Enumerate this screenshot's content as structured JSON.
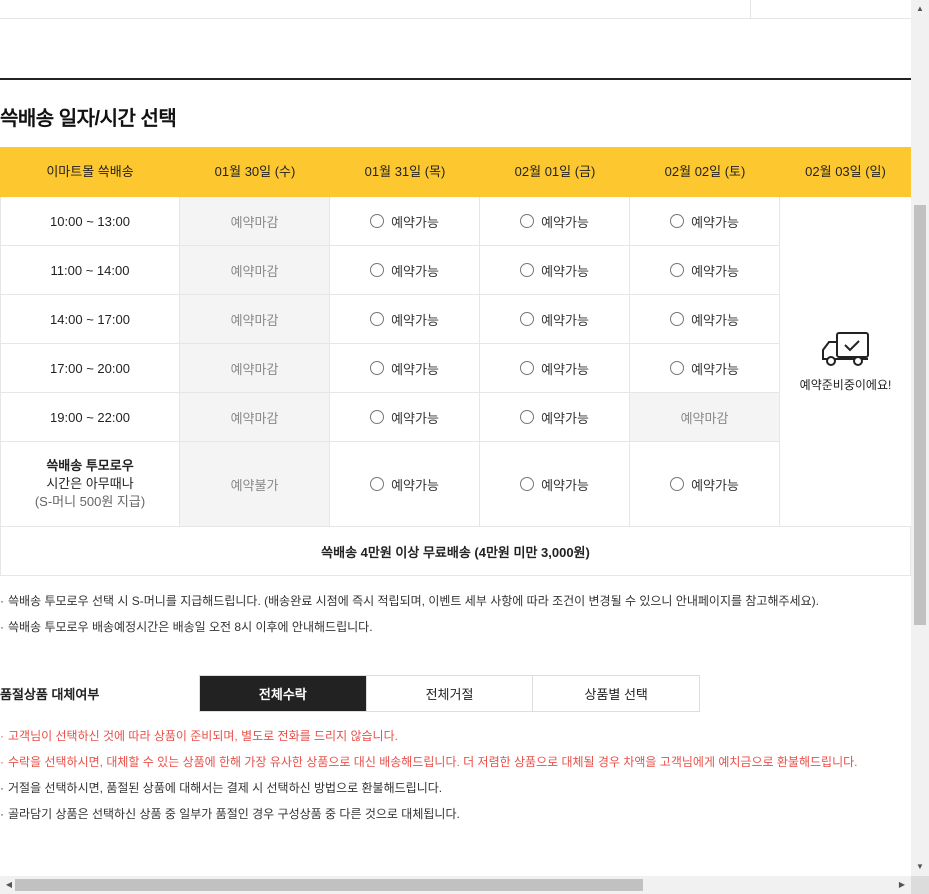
{
  "page": {
    "section_title": "쓱배송 일자/시간 선택"
  },
  "schedule": {
    "header": {
      "label": "이마트몰 쓱배송",
      "dates": [
        "01월 30일 (수)",
        "01월 31일 (목)",
        "02월 01일 (금)",
        "02월 02일 (토)",
        "02월 03일 (일)"
      ]
    },
    "rows": [
      {
        "time": "10:00 ~ 13:00",
        "slots": [
          "예약마감",
          "예약가능",
          "예약가능",
          "예약가능"
        ]
      },
      {
        "time": "11:00 ~ 14:00",
        "slots": [
          "예약마감",
          "예약가능",
          "예약가능",
          "예약가능"
        ]
      },
      {
        "time": "14:00 ~ 17:00",
        "slots": [
          "예약마감",
          "예약가능",
          "예약가능",
          "예약가능"
        ]
      },
      {
        "time": "17:00 ~ 20:00",
        "slots": [
          "예약마감",
          "예약가능",
          "예약가능",
          "예약가능"
        ]
      },
      {
        "time": "19:00 ~ 22:00",
        "slots": [
          "예약마감",
          "예약가능",
          "예약가능",
          "예약마감"
        ]
      }
    ],
    "tomorrow": {
      "title": "쓱배송 투모로우",
      "line2": "시간은 아무때나",
      "line3": "(S-머니 500원 지급)",
      "slots": [
        "예약불가",
        "예약가능",
        "예약가능",
        "예약가능"
      ]
    },
    "preparing": {
      "text": "예약준비중이에요!",
      "icon": "delivery-truck-check-icon"
    },
    "fee_note": "쓱배송 4만원 이상 무료배송 (4만원 미만 3,000원)"
  },
  "notes": [
    "쓱배송 투모로우 선택 시 S-머니를 지급해드립니다. (배송완료 시점에 즉시 적립되며, 이벤트 세부 사항에 따라 조건이 변경될 수 있으니 안내페이지를 참고해주세요).",
    "쓱배송 투모로우 배송예정시간은 배송일 오전 8시 이후에 안내해드립니다."
  ],
  "substitution": {
    "label": "품절상품 대체여부",
    "options": [
      "전체수락",
      "전체거절",
      "상품별 선택"
    ],
    "selected": "전체수락",
    "notes": [
      {
        "text": "고객님이 선택하신 것에 따라 상품이 준비되며, 별도로 전화를 드리지 않습니다.",
        "red": true
      },
      {
        "text": "수락을 선택하시면, 대체할 수 있는 상품에 한해 가장 유사한 상품으로 대신 배송해드립니다. 더 저렴한 상품으로 대체될 경우 차액을 고객님에게 예치금으로 환불해드립니다.",
        "red": true
      },
      {
        "text": "거절을 선택하시면, 품절된 상품에 대해서는 결제 시 선택하신 방법으로 환불해드립니다.",
        "red": false
      },
      {
        "text": "골라담기 상품은 선택하신 상품 중 일부가 품절인 경우 구성상품 중 다른 것으로 대체됩니다.",
        "red": false
      }
    ]
  },
  "colors": {
    "header_bg": "#fdc82f",
    "closed_bg": "#f4f4f4",
    "active_tab_bg": "#222222",
    "notice_red": "#e8504a"
  }
}
